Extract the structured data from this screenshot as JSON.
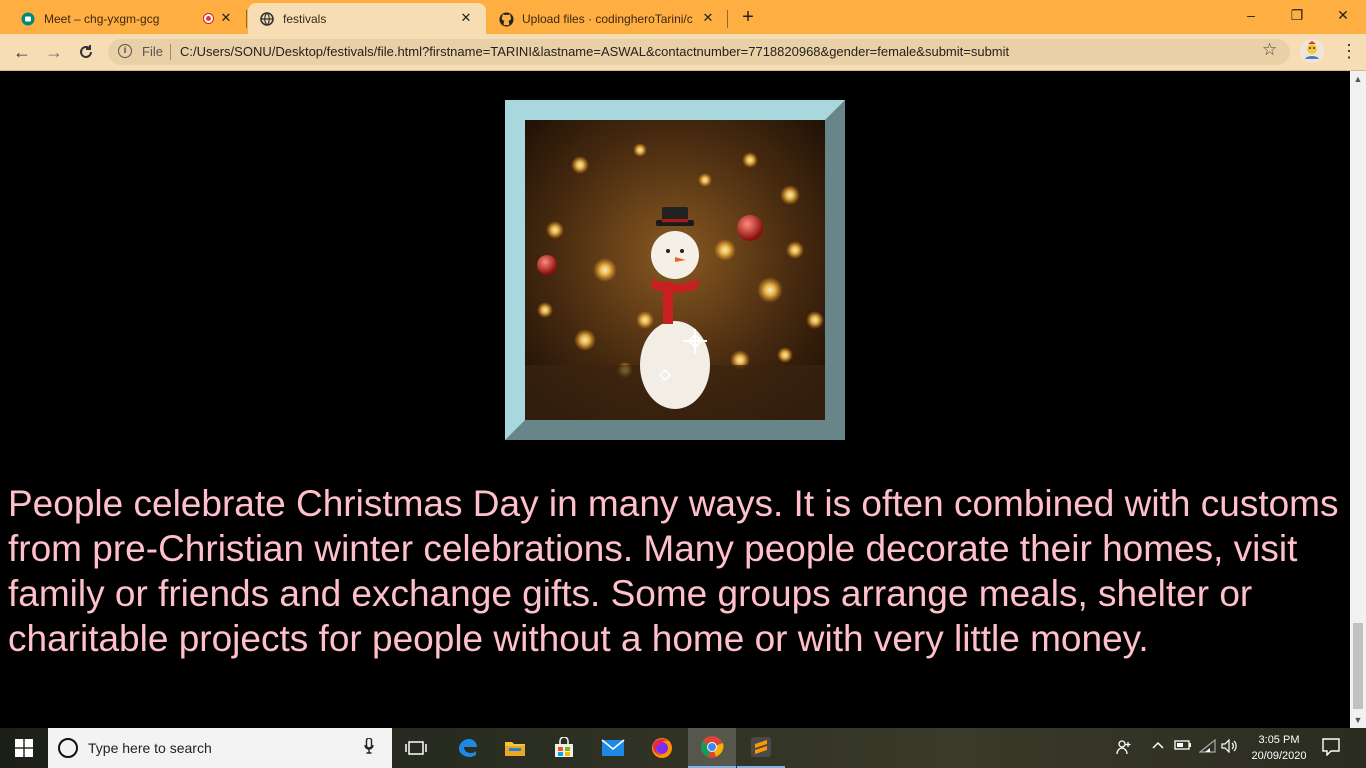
{
  "browser": {
    "tabs": [
      {
        "title": "Meet – chg-yxgm-gcg",
        "favicon": "meet-icon",
        "recording": true
      },
      {
        "title": "festivals",
        "favicon": "globe-icon",
        "active": true
      },
      {
        "title": "Upload files · codingheroTarini/c",
        "favicon": "github-icon"
      }
    ],
    "new_tab": "+",
    "omnibox": {
      "scheme_label": "File",
      "url": "C:/Users/SONU/Desktop/festivals/file.html?firstname=TARINI&lastname=ASWAL&contactnumber=7718820968&gender=female&submit=submit"
    }
  },
  "page": {
    "image": {
      "subject": "snowman with bokeh christmas lights",
      "frame_color": "#A8D8DE"
    },
    "paragraph": "People celebrate Christmas Day in many ways. It is often combined with customs from pre-Christian winter celebrations. Many people decorate their homes, visit family or friends and exchange gifts. Some groups arrange meals, shelter or charitable projects for people without a home or with very little money.",
    "text_color": "#FFC0CB",
    "background": "#000000"
  },
  "taskbar": {
    "search_placeholder": "Type here to search",
    "pinned": [
      "task-view-icon",
      "edge-icon",
      "file-explorer-icon",
      "store-icon",
      "mail-icon",
      "firefox-icon",
      "chrome-icon",
      "sublime-icon"
    ],
    "clock": {
      "time": "3:05 PM",
      "date": "20/09/2020"
    }
  },
  "colors": {
    "tab_strip": "#FFAE42",
    "toolbar": "#F6DDB4"
  }
}
